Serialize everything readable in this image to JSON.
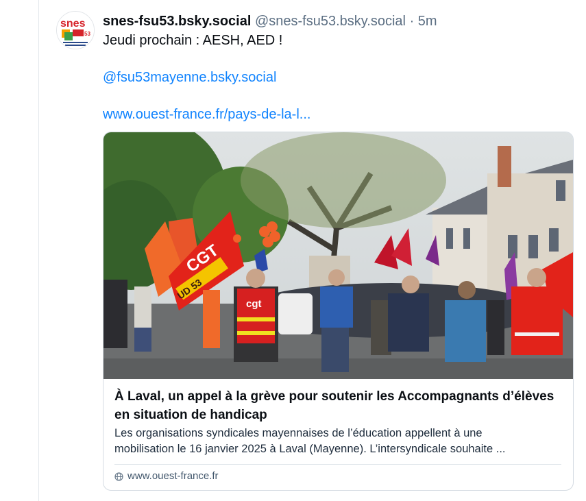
{
  "post": {
    "display_name": "snes-fsu53.bsky.social",
    "handle": "@snes-fsu53.bsky.social",
    "separator": "·",
    "time": "5m",
    "text_line1": "Jeudi prochain : AESH, AED !",
    "mention": "@fsu53mayenne.bsky.social",
    "link": "www.ouest-france.fr/pays-de-la-l..."
  },
  "avatar": {
    "logo_text": "snes",
    "badge_text": "53"
  },
  "card": {
    "image_flag_text_1": "CGT",
    "image_flag_text_2": "UD 53",
    "image_vest_text": "cgt",
    "title": "À Laval, un appel à la grève pour soutenir les Accompagnants d’élèves en situation de handicap",
    "description_line1": "Les organisations syndicales mayennaises de l’éducation appellent à une",
    "description_line2": "mobilisation le 16 janvier 2025 à Laval (Mayenne). L’intersyndicale souhaite ...",
    "domain": "www.ouest-france.fr"
  },
  "colors": {
    "link": "#1083fe",
    "muted": "#5b6e82",
    "cgt_red": "#e2231a"
  }
}
